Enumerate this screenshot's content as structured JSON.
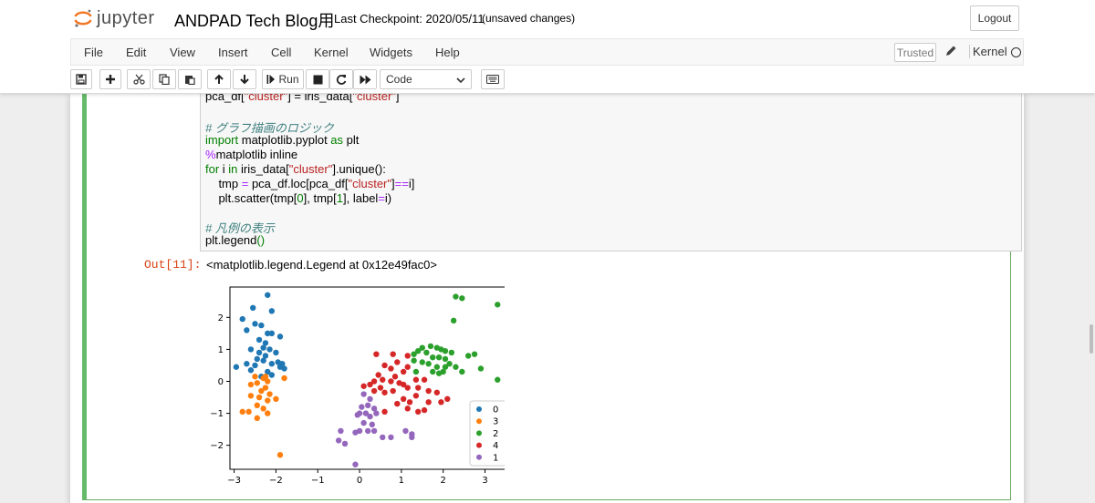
{
  "header": {
    "logo_text": "jupyter",
    "notebook_name": "ANDPAD Tech Blog用",
    "checkpoint": "Last Checkpoint: 2020/05/11",
    "unsaved": "(unsaved changes)",
    "logout": "Logout"
  },
  "menu": {
    "items": [
      "File",
      "Edit",
      "View",
      "Insert",
      "Cell",
      "Kernel",
      "Widgets",
      "Help"
    ],
    "trusted": "Trusted",
    "kernel_label": "Kernel"
  },
  "toolbar": {
    "run_label": "Run",
    "cell_type": "Code",
    "icons": [
      "save-icon",
      "plus-icon",
      "cut-icon",
      "copy-icon",
      "paste-icon",
      "arrow-up-icon",
      "arrow-down-icon",
      "step-icon",
      "stop-icon",
      "restart-icon",
      "fast-forward-icon",
      "keyboard-icon"
    ]
  },
  "cell": {
    "code_line_1_a": "pca_df[",
    "code_line_1_str1": "\"cluster\"",
    "code_line_1_b": "] = iris_data[",
    "code_line_1_str2": "\"cluster\"",
    "code_line_1_c": "]",
    "comment_1": "# グラフ描画のロジック",
    "import_kw": "import",
    "import_mod": " matplotlib.pyplot ",
    "as_kw": "as",
    "as_name": " plt",
    "magic_pct": "%",
    "magic_rest": "matplotlib inline",
    "for_kw": "for",
    "for_var": " i ",
    "in_kw": "in",
    "for_a": " iris_data[",
    "for_str": "\"cluster\"",
    "for_b": "].unique():",
    "tmp_a": "    tmp ",
    "tmp_eq": "=",
    "tmp_b": " pca_df.loc[pca_df[",
    "tmp_str": "\"cluster\"",
    "tmp_c": "]",
    "tmp_eqeq": "==",
    "tmp_d": "i]",
    "sc_a": "    plt.scatter(tmp[",
    "sc_0": "0",
    "sc_b": "], tmp[",
    "sc_1": "1",
    "sc_c": "], label",
    "sc_eq": "=",
    "sc_d": "i)",
    "comment_2": "# 凡例の表示",
    "legend_a": "plt.legend",
    "legend_b": "()",
    "out_prompt": "Out[11]:",
    "out_text": "<matplotlib.legend.Legend at 0x12e49fac0>"
  },
  "chart_data": {
    "type": "scatter",
    "xlim": [
      -3.1,
      3.6
    ],
    "ylim": [
      -2.75,
      2.95
    ],
    "xticks": [
      -3,
      -2,
      -1,
      0,
      1,
      2,
      3
    ],
    "yticks": [
      -2,
      -1,
      0,
      1,
      2
    ],
    "legend_position": "lower-right",
    "series": [
      {
        "name": "0",
        "color": "#1f77b4",
        "points": [
          [
            -2.2,
            2.7
          ],
          [
            -2.55,
            2.3
          ],
          [
            -2.1,
            2.2
          ],
          [
            -2.8,
            1.95
          ],
          [
            -2.5,
            1.8
          ],
          [
            -2.35,
            1.75
          ],
          [
            -2.7,
            1.6
          ],
          [
            -2.2,
            1.5
          ],
          [
            -2.1,
            1.5
          ],
          [
            -2.4,
            1.3
          ],
          [
            -2.25,
            1.2
          ],
          [
            -1.9,
            1.4
          ],
          [
            -2.6,
            1.0
          ],
          [
            -2.3,
            1.05
          ],
          [
            -2.15,
            1.0
          ],
          [
            -2.0,
            0.9
          ],
          [
            -2.45,
            0.7
          ],
          [
            -2.3,
            0.65
          ],
          [
            -1.95,
            0.6
          ],
          [
            -2.7,
            0.55
          ],
          [
            -2.5,
            0.5
          ],
          [
            -2.6,
            0.35
          ],
          [
            -2.2,
            0.3
          ],
          [
            -1.9,
            0.45
          ],
          [
            -1.8,
            0.4
          ],
          [
            -2.95,
            0.45
          ],
          [
            -2.1,
            0.2
          ],
          [
            -2.35,
            0.15
          ],
          [
            -2.25,
            0.8
          ],
          [
            -1.85,
            0.55
          ],
          [
            -2.4,
            0.9
          ],
          [
            -2.1,
            0.55
          ]
        ]
      },
      {
        "name": "3",
        "color": "#ff7f0e",
        "points": [
          [
            -2.25,
            0.15
          ],
          [
            -2.5,
            0.15
          ],
          [
            -2.3,
            0.1
          ],
          [
            -1.8,
            0.1
          ],
          [
            -2.45,
            -0.05
          ],
          [
            -2.2,
            0.0
          ],
          [
            -2.6,
            -0.1
          ],
          [
            -2.25,
            -0.2
          ],
          [
            -2.35,
            -0.3
          ],
          [
            -2.15,
            -0.4
          ],
          [
            -2.6,
            -0.45
          ],
          [
            -2.4,
            -0.5
          ],
          [
            -2.0,
            -0.55
          ],
          [
            -2.2,
            -0.6
          ],
          [
            -2.45,
            -0.75
          ],
          [
            -2.3,
            -0.85
          ],
          [
            -2.65,
            -0.95
          ],
          [
            -2.8,
            -0.95
          ],
          [
            -2.2,
            -1.0
          ],
          [
            -2.45,
            -1.15
          ],
          [
            -1.9,
            -2.3
          ]
        ]
      },
      {
        "name": "2",
        "color": "#2ca02c",
        "points": [
          [
            2.3,
            2.65
          ],
          [
            2.45,
            2.6
          ],
          [
            2.25,
            1.9
          ],
          [
            3.3,
            2.4
          ],
          [
            1.5,
            1.05
          ],
          [
            1.7,
            1.1
          ],
          [
            1.85,
            1.05
          ],
          [
            1.95,
            1.0
          ],
          [
            2.05,
            0.95
          ],
          [
            1.3,
            0.85
          ],
          [
            1.4,
            0.95
          ],
          [
            1.6,
            0.9
          ],
          [
            2.2,
            0.9
          ],
          [
            1.75,
            0.75
          ],
          [
            1.9,
            0.75
          ],
          [
            2.05,
            0.7
          ],
          [
            2.6,
            0.8
          ],
          [
            2.75,
            0.85
          ],
          [
            1.3,
            0.65
          ],
          [
            1.5,
            0.6
          ],
          [
            1.65,
            0.55
          ],
          [
            1.85,
            0.45
          ],
          [
            2.05,
            0.45
          ],
          [
            2.3,
            0.45
          ],
          [
            2.45,
            0.3
          ],
          [
            1.9,
            0.25
          ],
          [
            1.35,
            0.3
          ],
          [
            2.0,
            0.3
          ],
          [
            2.9,
            0.4
          ],
          [
            3.3,
            0.05
          ],
          [
            2.15,
            0.55
          ],
          [
            1.75,
            0.3
          ]
        ]
      },
      {
        "name": "4",
        "color": "#d62728",
        "points": [
          [
            0.4,
            0.85
          ],
          [
            0.8,
            0.85
          ],
          [
            1.15,
            0.8
          ],
          [
            0.9,
            0.6
          ],
          [
            0.6,
            0.5
          ],
          [
            0.75,
            0.4
          ],
          [
            1.15,
            0.45
          ],
          [
            1.05,
            0.3
          ],
          [
            0.45,
            0.2
          ],
          [
            0.85,
            0.15
          ],
          [
            0.55,
            0.05
          ],
          [
            0.75,
            0.0
          ],
          [
            0.35,
            0.0
          ],
          [
            0.1,
            -0.15
          ],
          [
            0.25,
            -0.1
          ],
          [
            0.5,
            -0.2
          ],
          [
            0.95,
            -0.05
          ],
          [
            1.05,
            -0.1
          ],
          [
            1.35,
            0.05
          ],
          [
            1.55,
            0.05
          ],
          [
            0.35,
            -0.3
          ],
          [
            0.6,
            -0.35
          ],
          [
            0.8,
            -0.3
          ],
          [
            1.15,
            -0.2
          ],
          [
            1.4,
            -0.2
          ],
          [
            1.65,
            -0.3
          ],
          [
            1.85,
            -0.35
          ],
          [
            1.35,
            -0.45
          ],
          [
            1.05,
            -0.55
          ],
          [
            1.2,
            -0.65
          ],
          [
            0.9,
            -0.7
          ],
          [
            1.15,
            -0.85
          ],
          [
            1.4,
            -0.95
          ],
          [
            1.55,
            -0.9
          ],
          [
            1.65,
            -0.65
          ],
          [
            1.95,
            -0.65
          ],
          [
            2.1,
            -0.55
          ],
          [
            0.6,
            -0.95
          ]
        ]
      },
      {
        "name": "1",
        "color": "#9467bd",
        "points": [
          [
            0.1,
            -0.4
          ],
          [
            0.25,
            -0.55
          ],
          [
            0.2,
            -0.75
          ],
          [
            0.05,
            -0.8
          ],
          [
            0.35,
            -0.85
          ],
          [
            0.15,
            -1.0
          ],
          [
            -0.05,
            -1.05
          ],
          [
            0.0,
            -1.0
          ],
          [
            0.25,
            -1.1
          ],
          [
            0.4,
            -1.0
          ],
          [
            0.1,
            -1.3
          ],
          [
            0.3,
            -1.35
          ],
          [
            0.2,
            -1.55
          ],
          [
            0.0,
            -1.55
          ],
          [
            -0.1,
            -1.6
          ],
          [
            0.35,
            -1.55
          ],
          [
            0.55,
            -1.75
          ],
          [
            0.75,
            -1.75
          ],
          [
            1.1,
            -1.55
          ],
          [
            1.25,
            -1.65
          ],
          [
            1.25,
            -1.75
          ],
          [
            -0.45,
            -1.55
          ],
          [
            -0.5,
            -1.85
          ],
          [
            -0.35,
            -1.95
          ],
          [
            -0.1,
            -2.6
          ]
        ]
      }
    ]
  }
}
